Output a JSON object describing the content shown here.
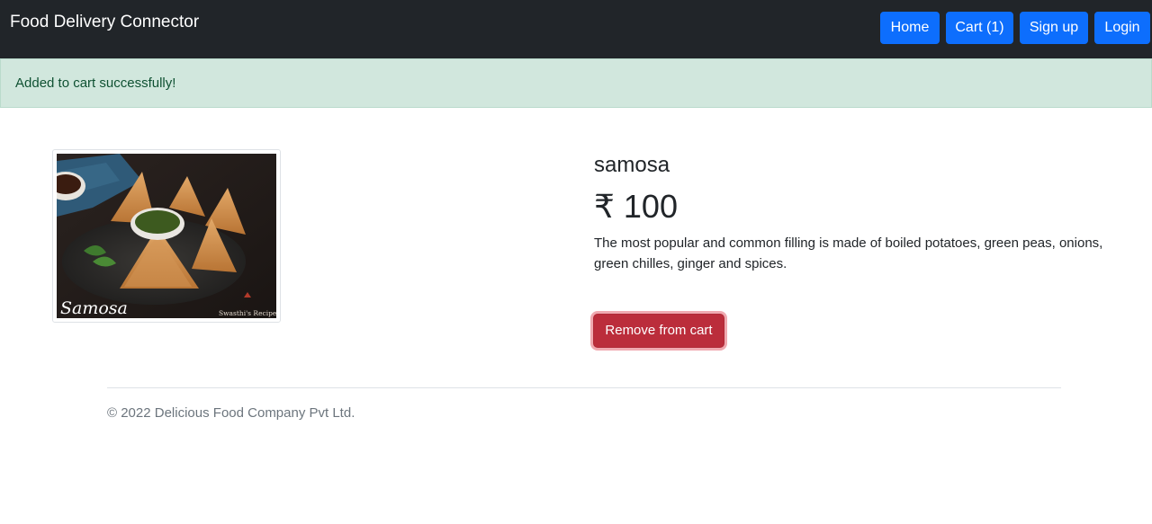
{
  "navbar": {
    "brand": "Food Delivery Connector",
    "buttons": {
      "home": "Home",
      "cart": "Cart (1)",
      "signup": "Sign up",
      "login": "Login"
    }
  },
  "alert": {
    "message": "Added to cart successfully!"
  },
  "product": {
    "image_caption": "Samosa",
    "image_watermark": "Swasthi's Recipes",
    "name": "samosa",
    "price": "₹ 100",
    "description": "The most popular and common filling is made of boiled potatoes, green peas, onions, green chilles, ginger and spices.",
    "remove_label": "Remove from cart"
  },
  "footer": {
    "copyright": "© 2022 Delicious Food Company Pvt Ltd."
  },
  "colors": {
    "navbar_bg": "#212529",
    "primary": "#0d6efd",
    "danger": "#bb2d3b",
    "alert_bg": "#d1e7dd",
    "alert_text": "#0f5132"
  }
}
